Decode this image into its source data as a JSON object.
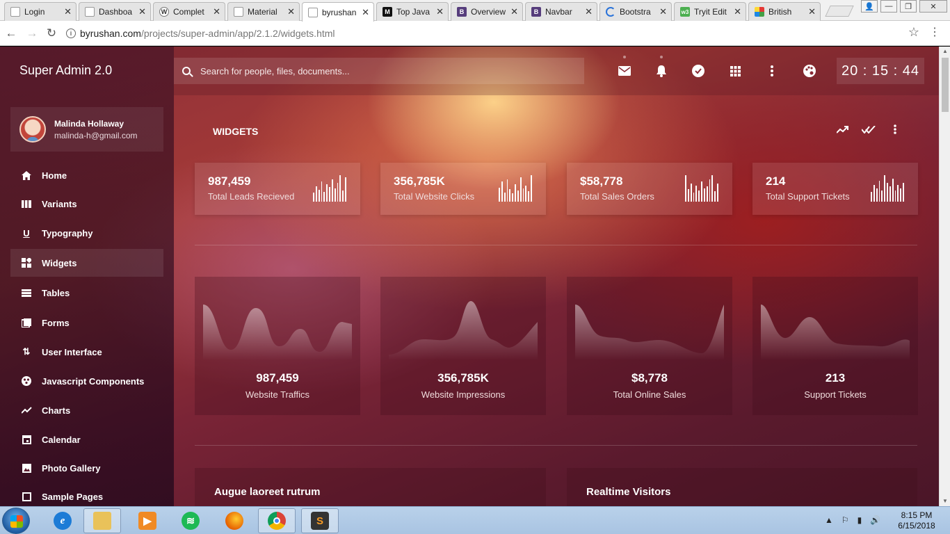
{
  "browser": {
    "tabs": [
      {
        "label": "Login",
        "icon": "page-icon"
      },
      {
        "label": "Dashboa",
        "icon": "page-icon"
      },
      {
        "label": "Complet",
        "icon": "wordpress-icon"
      },
      {
        "label": "Material",
        "icon": "page-icon"
      },
      {
        "label": "byrushan",
        "icon": "page-icon"
      },
      {
        "label": "Top Java",
        "icon": "medium-icon"
      },
      {
        "label": "Overview",
        "icon": "bootstrap-icon"
      },
      {
        "label": "Navbar",
        "icon": "bootstrap-icon"
      },
      {
        "label": "Bootstra",
        "icon": "loading-icon"
      },
      {
        "label": "Tryit Edit",
        "icon": "w3schools-icon"
      },
      {
        "label": "British",
        "icon": "grid-icon"
      }
    ],
    "url_host": "byrushan.com",
    "url_path": "/projects/super-admin/app/2.1.2/widgets.html"
  },
  "app": {
    "brand": "Super Admin 2.0",
    "search_placeholder": "Search for people, files, documents...",
    "clock": "20 : 15 : 44",
    "user": {
      "name": "Malinda Hollaway",
      "email": "malinda-h@gmail.com"
    },
    "nav": [
      {
        "label": "Home",
        "icon": "home-icon"
      },
      {
        "label": "Variants",
        "icon": "columns-icon"
      },
      {
        "label": "Typography",
        "icon": "underline-icon"
      },
      {
        "label": "Widgets",
        "icon": "widgets-icon",
        "active": true
      },
      {
        "label": "Tables",
        "icon": "table-icon"
      },
      {
        "label": "Forms",
        "icon": "forms-icon"
      },
      {
        "label": "User Interface",
        "icon": "swap-icon"
      },
      {
        "label": "Javascript Components",
        "icon": "components-icon"
      },
      {
        "label": "Charts",
        "icon": "trending-icon"
      },
      {
        "label": "Calendar",
        "icon": "calendar-icon"
      },
      {
        "label": "Photo Gallery",
        "icon": "image-icon"
      },
      {
        "label": "Sample Pages",
        "icon": "pages-icon"
      }
    ],
    "page_title": "WIDGETS",
    "stats": [
      {
        "value": "987,459",
        "label": "Total Leads Recieved",
        "spark": [
          8,
          14,
          11,
          18,
          9,
          16,
          13,
          20,
          12,
          17,
          24,
          10,
          22
        ]
      },
      {
        "value": "356,785K",
        "label": "Total Website Clicks",
        "spark": [
          14,
          20,
          9,
          22,
          12,
          8,
          17,
          11,
          24,
          13,
          16,
          10,
          26
        ]
      },
      {
        "value": "$58,778",
        "label": "Total Sales Orders",
        "spark": [
          26,
          12,
          18,
          9,
          16,
          11,
          20,
          13,
          15,
          22,
          26,
          10,
          18
        ]
      },
      {
        "value": "214",
        "label": "Total Support Tickets",
        "spark": [
          10,
          18,
          14,
          22,
          12,
          28,
          20,
          16,
          24,
          12,
          18,
          14,
          20
        ]
      }
    ],
    "overview": [
      {
        "value": "987,459",
        "label": "Website Traffics"
      },
      {
        "value": "356,785K",
        "label": "Website Impressions"
      },
      {
        "value": "$8,778",
        "label": "Total Online Sales"
      },
      {
        "value": "213",
        "label": "Support Tickets"
      }
    ],
    "panels": [
      {
        "title": "Augue laoreet rutrum"
      },
      {
        "title": "Realtime Visitors"
      }
    ]
  },
  "taskbar": {
    "time": "8:15 PM",
    "date": "6/15/2018"
  }
}
